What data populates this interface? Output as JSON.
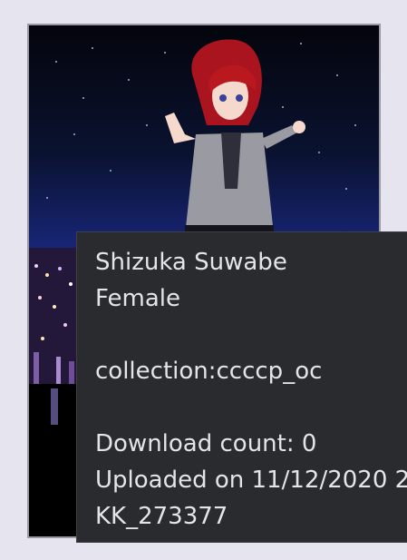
{
  "card": {
    "image_alt": "character thumbnail",
    "colors": {
      "sky_top": "#05060d",
      "sky_bottom": "#2c3fb2",
      "frame": "#9a99a3"
    }
  },
  "tooltip": {
    "name": "Shizuka Suwabe",
    "gender": "Female",
    "collection": "collection:ccccp_oc",
    "download_count": "Download count: 0",
    "uploaded": "Uploaded on 11/12/2020 2",
    "id": "KK_273377",
    "colors": {
      "background": "#2a2b2f",
      "text": "#e5e5e7"
    }
  }
}
